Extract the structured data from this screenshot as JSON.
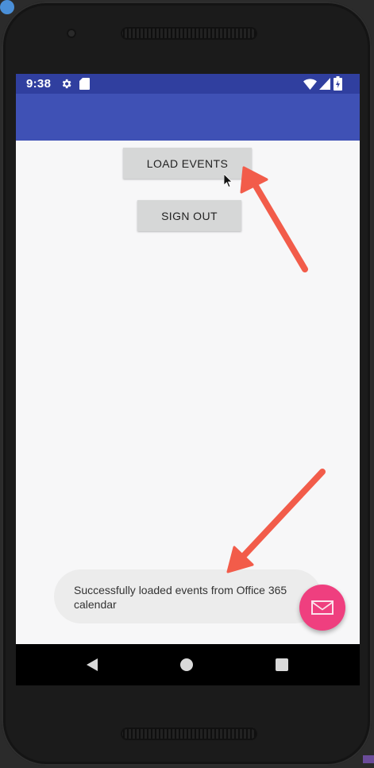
{
  "statusbar": {
    "time": "9:38"
  },
  "buttons": {
    "load_events": "LOAD EVENTS",
    "sign_out": "SIGN OUT"
  },
  "toast": {
    "message": "Successfully loaded events from Office 365 calendar"
  },
  "colors": {
    "statusbar": "#303f9f",
    "toolbar": "#3f51b5",
    "fab": "#ef3f7f",
    "annotation_arrow": "#f25c4a",
    "screen_background": "#f7f7f8"
  },
  "icons": {
    "status": [
      "settings-gear-icon",
      "sd-card-icon",
      "wifi-icon",
      "cell-signal-icon",
      "battery-icon"
    ],
    "fab": "mail-icon",
    "navigation": [
      "back-icon",
      "home-icon",
      "recents-icon"
    ]
  },
  "annotations": {
    "arrow_count": 2
  }
}
